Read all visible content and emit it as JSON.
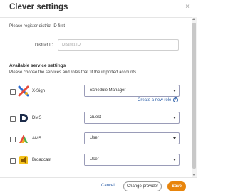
{
  "dialog": {
    "title": "Clever settings",
    "close_glyph": "×",
    "notice": "Please register district ID first",
    "district": {
      "label": "District ID",
      "placeholder": "District ID",
      "value": ""
    },
    "section_title": "Available service settings",
    "section_desc": "Please choose the services and roles that fit the imported accounts.",
    "services": [
      {
        "name": "X-Sign",
        "role": "Schedule Manager",
        "icon": "xsign-logo",
        "checked": false
      },
      {
        "name": "DMS",
        "role": "Guest",
        "icon": "dms-logo",
        "checked": false
      },
      {
        "name": "AMS",
        "role": "User",
        "icon": "ams-logo",
        "checked": false
      },
      {
        "name": "Broadcast",
        "role": "User",
        "icon": "broadcast-logo",
        "checked": false
      }
    ],
    "create_role_label": "Create a new role",
    "footer": {
      "cancel_label": "Cancel",
      "change_label": "Change provider",
      "save_label": "Save"
    }
  },
  "colors": {
    "accent": "#e8850c",
    "link": "#2d5fa8",
    "select_border": "#9a9cb8"
  }
}
